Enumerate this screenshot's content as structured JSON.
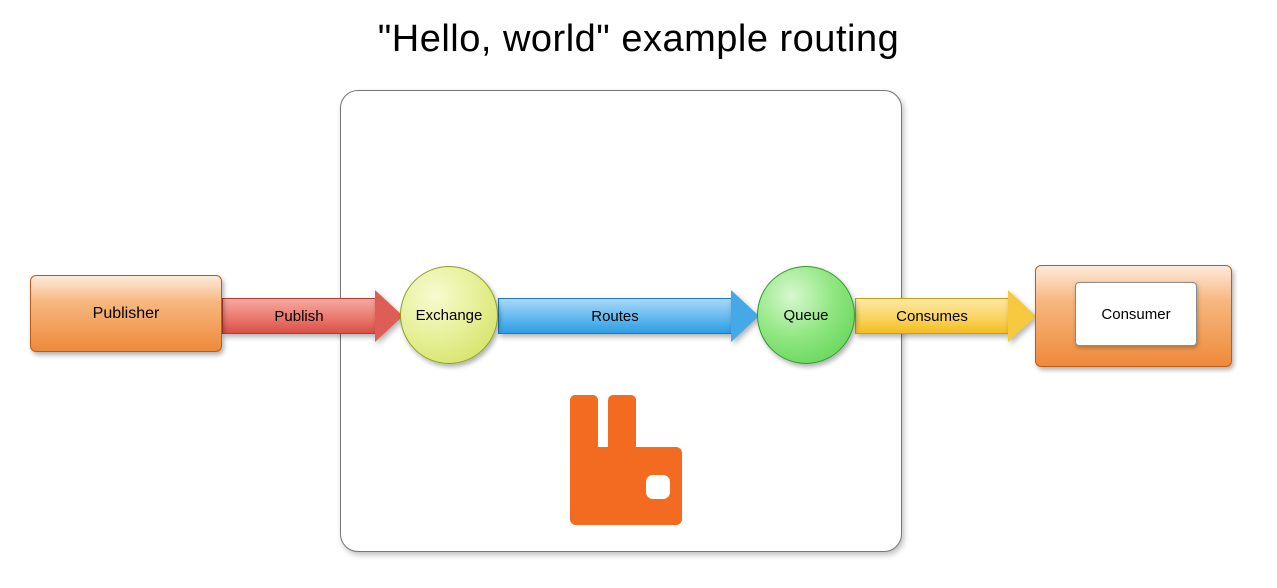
{
  "title": "\"Hello, world\" example routing",
  "nodes": {
    "publisher": {
      "label": "Publisher"
    },
    "exchange": {
      "label": "Exchange"
    },
    "queue": {
      "label": "Queue"
    },
    "consumer": {
      "label": "Consumer"
    }
  },
  "arrows": {
    "publish": {
      "label": "Publish",
      "color": "#de5e56"
    },
    "routes": {
      "label": "Routes",
      "color": "#45a9e8"
    },
    "consumes": {
      "label": "Consumes",
      "color": "#f6c93e"
    }
  },
  "logo": {
    "name": "rabbitmq",
    "color": "#f26b21"
  }
}
